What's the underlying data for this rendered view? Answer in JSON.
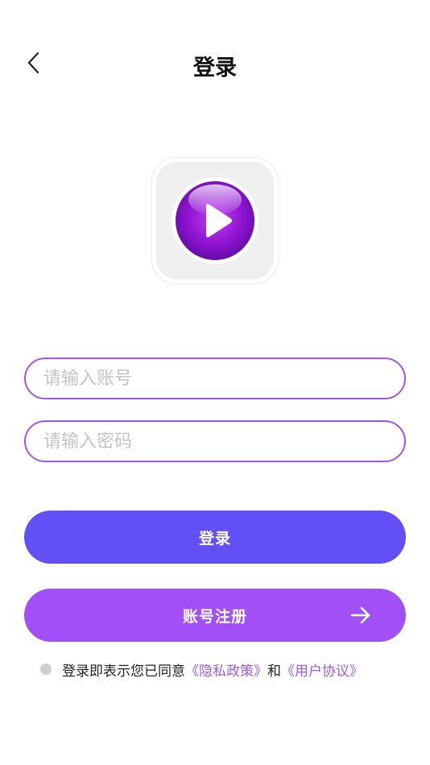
{
  "header": {
    "title": "登录"
  },
  "form": {
    "account_placeholder": "请输入账号",
    "password_placeholder": "请输入密码",
    "account_value": "",
    "password_value": ""
  },
  "buttons": {
    "login_label": "登录",
    "register_label": "账号注册"
  },
  "agreement": {
    "prefix": "登录即表示您已同意",
    "privacy_link": "《隐私政策》",
    "conjunction": "和",
    "terms_link": "《用户协议》"
  },
  "icons": {
    "back": "chevron-left-icon",
    "logo": "play-icon",
    "arrow": "arrow-right-icon"
  },
  "colors": {
    "input_border": "#9e56f0",
    "login_button": "#624ff6",
    "register_button": "#a24ff8",
    "link": "#9f5ae6",
    "logo_purple": "#8a12c9"
  }
}
